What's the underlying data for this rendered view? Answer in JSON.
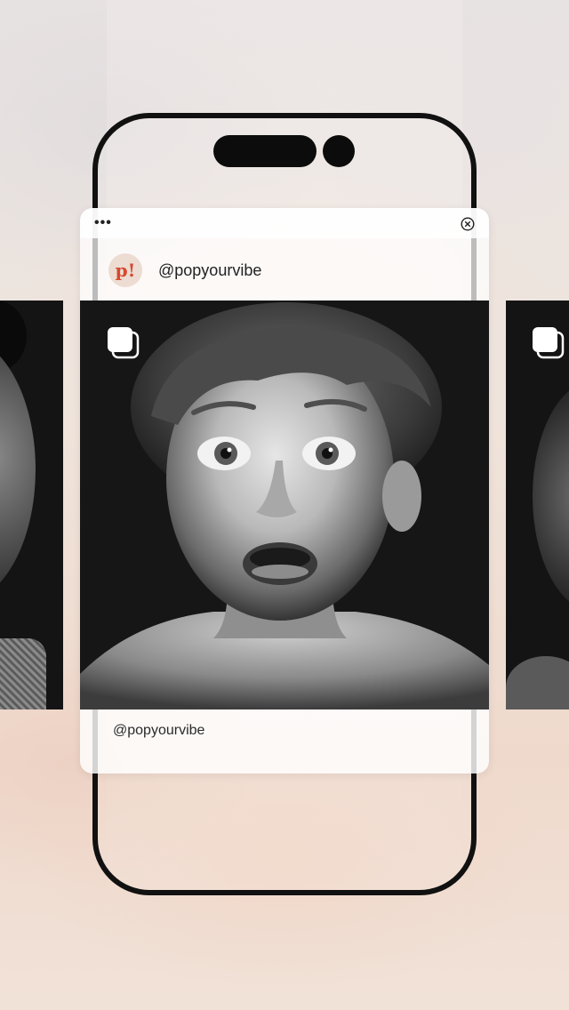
{
  "window": {
    "menu_icon": "more-horizontal-icon",
    "menu_glyph": "•••",
    "close_icon": "close-circle-icon"
  },
  "post": {
    "avatar_text": "p!",
    "username": "@popyourvibe",
    "caption": "@popyourvibe",
    "multi_image_icon": "multiple-images-icon"
  },
  "colors": {
    "brand": "#d6492f",
    "photo_background": "#161616",
    "phone_outline": "#111111"
  }
}
